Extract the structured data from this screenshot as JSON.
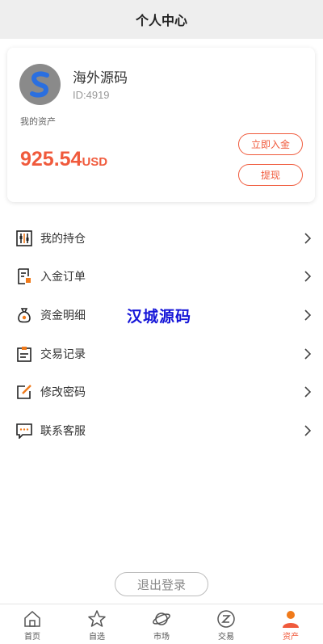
{
  "header": {
    "title": "个人中心"
  },
  "profile": {
    "name": "海外源码",
    "id_text": "ID:4919",
    "assets_label": "我的资产",
    "balance_value": "925.54",
    "balance_unit": "USD",
    "deposit_button": "立即入金",
    "withdraw_button": "提现"
  },
  "menu": {
    "items": [
      {
        "label": "我的持仓",
        "icon": "holdings-icon"
      },
      {
        "label": "入金订单",
        "icon": "deposit-orders-icon"
      },
      {
        "label": "资金明细",
        "icon": "money-bag-icon"
      },
      {
        "label": "交易记录",
        "icon": "clipboard-icon"
      },
      {
        "label": "修改密码",
        "icon": "edit-icon"
      },
      {
        "label": "联系客服",
        "icon": "chat-icon"
      }
    ]
  },
  "watermark": "汉城源码",
  "logout_button": "退出登录",
  "tabbar": {
    "items": [
      {
        "label": "首页",
        "icon": "home-icon"
      },
      {
        "label": "自选",
        "icon": "star-icon"
      },
      {
        "label": "市场",
        "icon": "planet-icon"
      },
      {
        "label": "交易",
        "icon": "exchange-icon"
      },
      {
        "label": "资产",
        "icon": "person-icon"
      }
    ],
    "active_index": 4
  },
  "colors": {
    "accent": "#f05a3c",
    "watermark": "#1515d8",
    "icon_orange": "#f07a1a"
  }
}
